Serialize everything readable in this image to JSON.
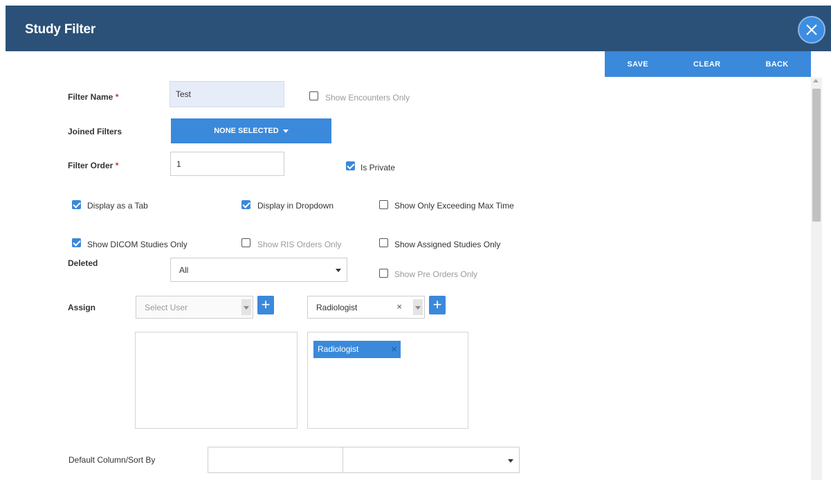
{
  "header": {
    "title": "Study Filter"
  },
  "actions": {
    "save": "SAVE",
    "clear": "CLEAR",
    "back": "BACK"
  },
  "form": {
    "filter_name": {
      "label": "Filter Name",
      "required_mark": "*",
      "value": "Test"
    },
    "show_encounters_only": {
      "label": "Show Encounters Only",
      "checked": false
    },
    "joined_filters": {
      "label": "Joined Filters",
      "button": "NONE SELECTED"
    },
    "filter_order": {
      "label": "Filter Order",
      "required_mark": "*",
      "value": "1"
    },
    "is_private": {
      "label": "Is Private",
      "checked": true
    },
    "display_as_tab": {
      "label": "Display as a Tab",
      "checked": true
    },
    "display_in_dropdown": {
      "label": "Display in Dropdown",
      "checked": true
    },
    "show_only_exceeding_max_time": {
      "label": "Show Only Exceeding Max Time",
      "checked": false
    },
    "show_dicom_studies_only": {
      "label": "Show DICOM Studies Only",
      "checked": true
    },
    "show_ris_orders_only": {
      "label": "Show RIS Orders Only",
      "checked": false
    },
    "show_assigned_studies_only": {
      "label": "Show Assigned Studies Only",
      "checked": false
    },
    "deleted": {
      "label": "Deleted",
      "value": "All"
    },
    "show_pre_orders_only": {
      "label": "Show Pre Orders Only",
      "checked": false
    },
    "assign": {
      "label": "Assign",
      "user_placeholder": "Select User",
      "role_value": "Radiologist",
      "role_clear": "×",
      "plus": "+",
      "assigned_roles": [
        "Radiologist"
      ],
      "chip_remove": "×"
    },
    "default_column": {
      "label": "Default Column/Sort By"
    }
  },
  "colors": {
    "header_bg": "#2b5178",
    "accent": "#3a89db"
  }
}
